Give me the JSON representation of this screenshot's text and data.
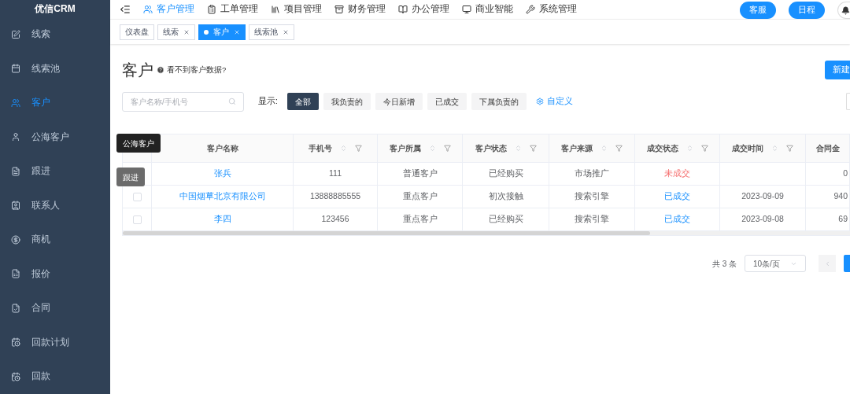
{
  "sidebar": {
    "brand": "优信CRM",
    "items": [
      {
        "label": "线索",
        "selected": false
      },
      {
        "label": "线索池",
        "selected": false
      },
      {
        "label": "客户",
        "selected": true
      },
      {
        "label": "公海客户",
        "selected": false
      },
      {
        "label": "跟进",
        "selected": false
      },
      {
        "label": "联系人",
        "selected": false
      },
      {
        "label": "商机",
        "selected": false
      },
      {
        "label": "报价",
        "selected": false
      },
      {
        "label": "合同",
        "selected": false
      },
      {
        "label": "回款计划",
        "selected": false
      },
      {
        "label": "回款",
        "selected": false
      }
    ],
    "tooltips": [
      {
        "text": "公海客户",
        "fading": false
      },
      {
        "text": "跟进",
        "fading": true
      }
    ]
  },
  "top_nav": {
    "items": [
      {
        "label": "客户管理",
        "selected": true
      },
      {
        "label": "工单管理",
        "selected": false
      },
      {
        "label": "项目管理",
        "selected": false
      },
      {
        "label": "财务管理",
        "selected": false
      },
      {
        "label": "办公管理",
        "selected": false
      },
      {
        "label": "商业智能",
        "selected": false
      },
      {
        "label": "系统管理",
        "selected": false
      }
    ],
    "buttons": [
      "客服",
      "日程"
    ]
  },
  "tabs": [
    {
      "label": "仪表盘",
      "selected": false,
      "closable": false
    },
    {
      "label": "线索",
      "selected": false,
      "closable": true
    },
    {
      "label": "客户",
      "selected": true,
      "closable": true
    },
    {
      "label": "线索池",
      "selected": false,
      "closable": true
    }
  ],
  "page": {
    "title": "客户",
    "help": "看不到客户数据?",
    "new_button": "新建",
    "search": {
      "placeholder": "客户名称/手机号"
    },
    "filter_label": "显示:",
    "filters": [
      {
        "label": "全部",
        "selected": true
      },
      {
        "label": "我负责的",
        "selected": false
      },
      {
        "label": "今日新增",
        "selected": false
      },
      {
        "label": "已成交",
        "selected": false
      },
      {
        "label": "下属负责的",
        "selected": false
      }
    ],
    "customize": "自定义"
  },
  "table": {
    "columns": [
      {
        "label": "客户名称",
        "sortable": false
      },
      {
        "label": "手机号",
        "sortable": true
      },
      {
        "label": "客户所属",
        "sortable": true
      },
      {
        "label": "客户状态",
        "sortable": true
      },
      {
        "label": "客户来源",
        "sortable": true
      },
      {
        "label": "成交状态",
        "sortable": true
      },
      {
        "label": "成交时间",
        "sortable": true
      },
      {
        "label": "合同金",
        "sortable": false
      }
    ],
    "rows": [
      {
        "name": "张兵",
        "phone": "111",
        "group": "普通客户",
        "status": "已经购买",
        "source": "市场推广",
        "deal": {
          "text": "未成交",
          "kind": "lost"
        },
        "date": "",
        "amount": "0"
      },
      {
        "checked": false,
        "name": "中国烟草北京有限公司",
        "phone": "13888885555",
        "group": "重点客户",
        "status": "初次接触",
        "source": "搜索引擎",
        "deal": {
          "text": "已成交",
          "kind": "won"
        },
        "date": "2023-09-09",
        "amount": "940"
      },
      {
        "checked": false,
        "name": "李四",
        "phone": "123456",
        "group": "重点客户",
        "status": "已经购买",
        "source": "搜索引擎",
        "deal": {
          "text": "已成交",
          "kind": "won"
        },
        "date": "2023-09-08",
        "amount": "69"
      }
    ]
  },
  "pagination": {
    "total": "共 3 条",
    "page_size": "10条/页"
  }
}
